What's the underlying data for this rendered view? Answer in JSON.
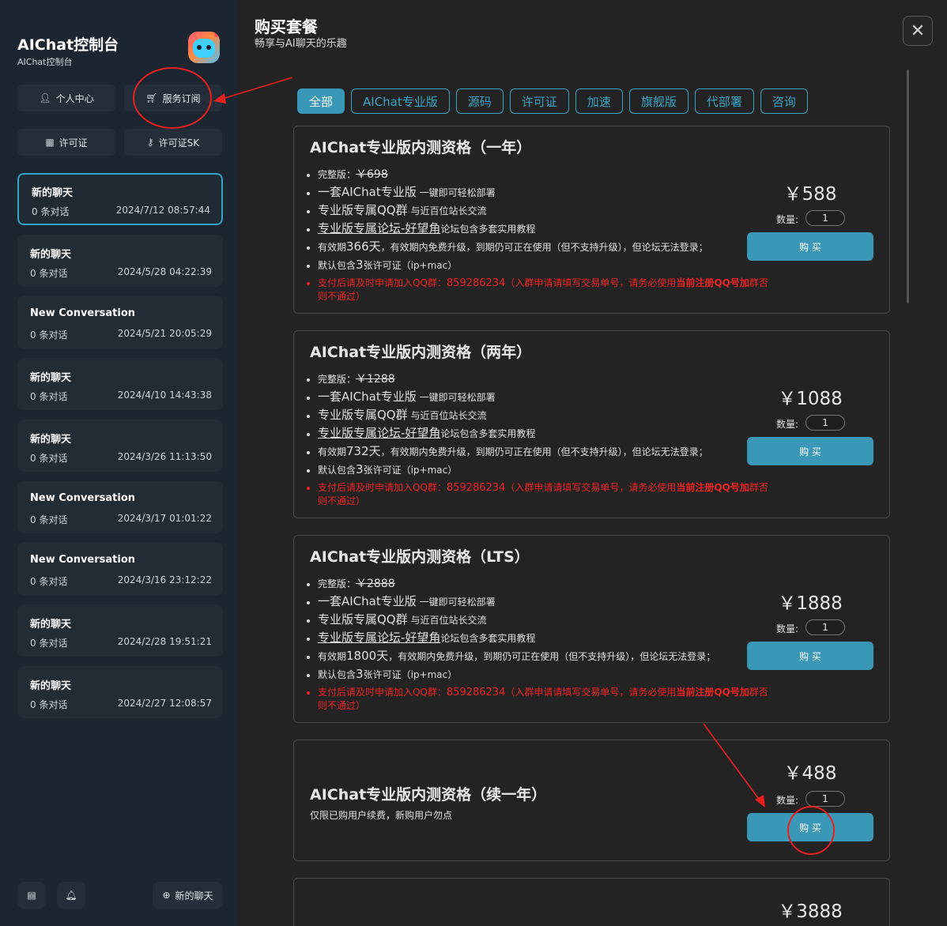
{
  "sidebar": {
    "app_title": "AIChat控制台",
    "app_subtitle": "AIChat控制台",
    "buttons": [
      {
        "label": "个人中心",
        "icon": "user-icon"
      },
      {
        "label": "服务订阅",
        "icon": "cart-icon"
      },
      {
        "label": "许可证",
        "icon": "id-card-icon"
      },
      {
        "label": "许可证SK",
        "icon": "key-icon"
      }
    ],
    "conversations": [
      {
        "title": "新的聊天",
        "count": "0 条对话",
        "date": "2024/7/12 08:57:44"
      },
      {
        "title": "新的聊天",
        "count": "0 条对话",
        "date": "2024/5/28 04:22:39"
      },
      {
        "title": "New Conversation",
        "count": "0 条对话",
        "date": "2024/5/21 20:05:29"
      },
      {
        "title": "新的聊天",
        "count": "0 条对话",
        "date": "2024/4/10 14:43:38"
      },
      {
        "title": "新的聊天",
        "count": "0 条对话",
        "date": "2024/3/26 11:13:50"
      },
      {
        "title": "New Conversation",
        "count": "0 条对话",
        "date": "2024/3/17 01:01:22"
      },
      {
        "title": "New Conversation",
        "count": "0 条对话",
        "date": "2024/3/16 23:12:22"
      },
      {
        "title": "新的聊天",
        "count": "0 条对话",
        "date": "2024/2/28 19:51:21"
      },
      {
        "title": "新的聊天",
        "count": "0 条对话",
        "date": "2024/2/27 12:08:57"
      }
    ],
    "new_chat_label": "新的聊天"
  },
  "main": {
    "title": "购买套餐",
    "subtitle": "畅享与AI聊天的乐趣",
    "close_glyph": "✕",
    "tabs": [
      "全部",
      "AIChat专业版",
      "源码",
      "许可证",
      "加速",
      "旗舰版",
      "代部署",
      "咨询"
    ],
    "qty_label": "数量:",
    "buy_label": "购 买",
    "common_features": {
      "full_prefix": "完整版：",
      "set_big": "一套AIChat专业版",
      "set_small": " 一键即可轻松部署",
      "qq_big": "专业版专属QQ群",
      "qq_small": " 与近百位站长交流",
      "forum_link": "专业版专属论坛-好望角",
      "forum_small": "论坛包含多套实用教程",
      "valid_prefix": "有效期",
      "valid_suffix": "，有效期内免费升级，到期仍可正在使用（但不支持升级），但论坛无法登录；",
      "license_prefix": "默认包含",
      "license_big": "3",
      "license_suffix": "张许可证（ip+mac）",
      "notice_a": "支付后请及时申请加入QQ群：",
      "notice_qq": "859286234",
      "notice_b": "（入群申请请填写交易单号，请务必使用",
      "notice_bold": "当前注册QQ号加",
      "notice_c": "群否则不通过）"
    },
    "products": [
      {
        "name": "AIChat专业版内测资格（一年）",
        "original_price": "￥698",
        "days": "366天",
        "price": "￥588",
        "qty": "1"
      },
      {
        "name": "AIChat专业版内测资格（两年）",
        "original_price": "￥1288",
        "days": "732天",
        "price": "￥1088",
        "qty": "1"
      },
      {
        "name": "AIChat专业版内测资格（LTS）",
        "original_price": "￥2888",
        "days": "1800天",
        "price": "￥1888",
        "qty": "1"
      },
      {
        "name": "AIChat专业版内测资格（续一年）",
        "note": "仅限已购用户续费，新购用户勿点",
        "price": "￥488",
        "qty": "1"
      },
      {
        "price": "￥3888"
      }
    ]
  },
  "colors": {
    "accent": "#3a97b6",
    "annotation": "#e8201e",
    "notice": "#e22222"
  }
}
